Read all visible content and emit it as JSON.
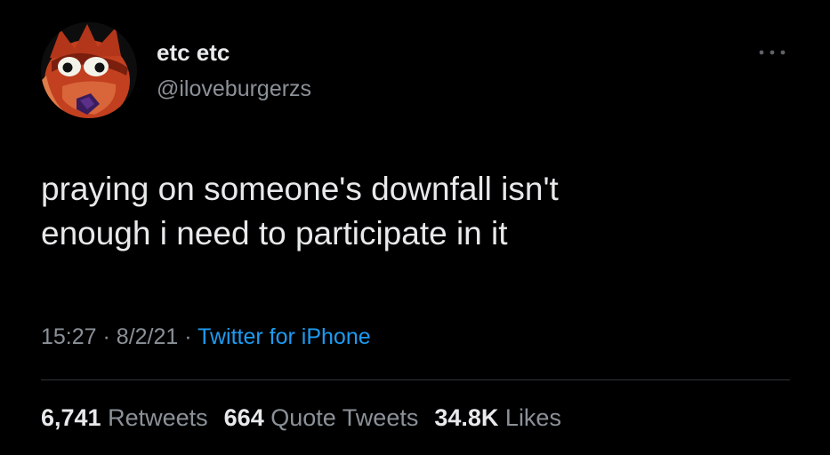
{
  "author": {
    "display_name": "etc etc",
    "handle": "@iloveburgerzs",
    "avatar_icon": "cartoon-character-avatar"
  },
  "more_icon": "more-options-icon",
  "tweet": {
    "text_line_1": "praying on someone's downfall isn't",
    "text_line_2": "enough i need to participate in it",
    "time": "15:27",
    "separator": "·",
    "date": "8/2/21",
    "source": "Twitter for iPhone"
  },
  "stats": {
    "retweets_count": "6,741",
    "retweets_label": "Retweets",
    "quotes_count": "664",
    "quotes_label": "Quote Tweets",
    "likes_count": "34.8K",
    "likes_label": "Likes"
  },
  "colors": {
    "background": "#000000",
    "text_primary": "#e7e9ea",
    "text_secondary": "#8b9198",
    "link": "#1d9bf0"
  }
}
